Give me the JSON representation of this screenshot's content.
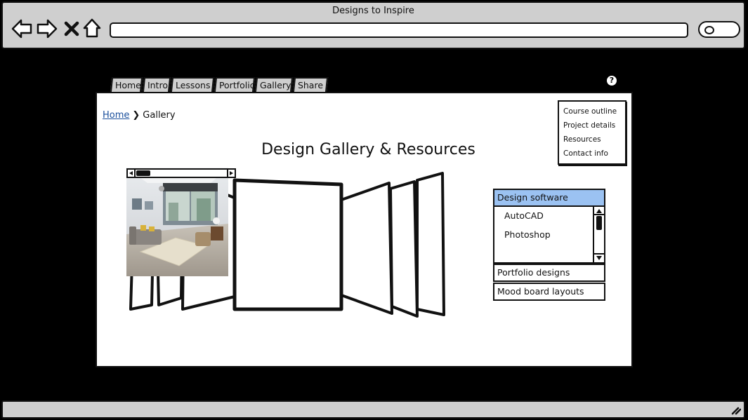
{
  "window": {
    "title": "Designs to Inspire"
  },
  "toolbar": {
    "back_icon": "back-arrow-icon",
    "forward_icon": "forward-arrow-icon",
    "stop_icon": "close-icon",
    "home_icon": "home-icon",
    "url": "",
    "search_icon": "search-icon"
  },
  "tabs": [
    "Home",
    "Intro",
    "Lessons",
    "Portfolio",
    "Gallery",
    "Share"
  ],
  "help_label": "?",
  "breadcrumb": {
    "home": "Home",
    "separator": "❯",
    "current": "Gallery"
  },
  "page_title": "Design Gallery & Resources",
  "side_links": [
    "Course outline",
    "Project details",
    "Resources",
    "Contact info"
  ],
  "accordion": {
    "sections": [
      {
        "label": "Design software",
        "expanded": true,
        "items": [
          "AutoCAD",
          "Photoshop"
        ]
      },
      {
        "label": "Portfolio designs",
        "expanded": false
      },
      {
        "label": "Mood board layouts",
        "expanded": false
      }
    ]
  },
  "colors": {
    "chrome": "#cfcfcf",
    "accent": "#9bc2f2",
    "link": "#1a4f9c"
  }
}
